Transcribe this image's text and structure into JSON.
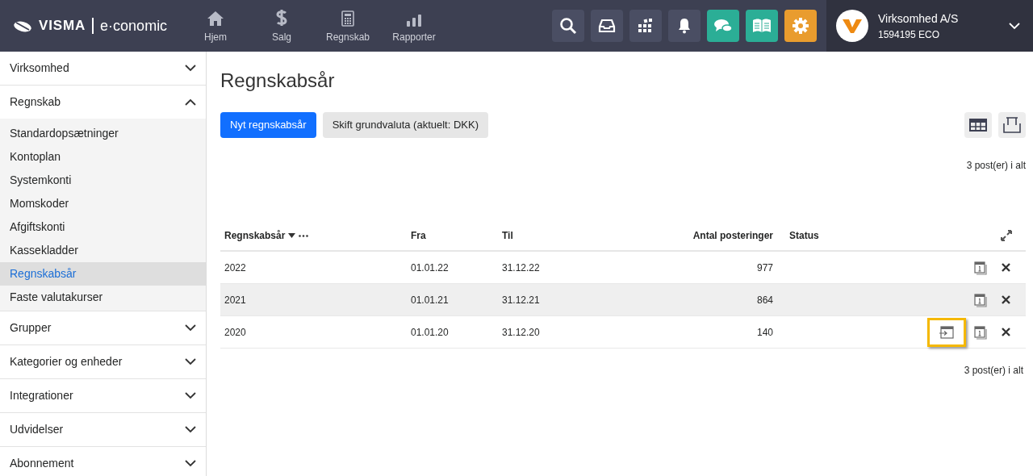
{
  "header": {
    "logo": {
      "brand": "VISMA",
      "product": "e·conomic"
    },
    "nav": [
      {
        "kind": "home",
        "label": "Hjem"
      },
      {
        "kind": "dollar",
        "label": "Salg"
      },
      {
        "kind": "calculator",
        "label": "Regnskab"
      },
      {
        "kind": "bars",
        "label": "Rapporter"
      }
    ],
    "tools": [
      {
        "kind": "search",
        "color": "#4a4e63"
      },
      {
        "kind": "inbox",
        "color": "#4a4e63"
      },
      {
        "kind": "apps",
        "color": "#4a4e63"
      },
      {
        "kind": "bell",
        "color": "#4a4e63"
      },
      {
        "kind": "chat",
        "color": "#2bae96"
      },
      {
        "kind": "book",
        "color": "#2bae96"
      },
      {
        "kind": "gear",
        "color": "#e99c2e"
      }
    ],
    "company": {
      "name": "Virksomhed A/S",
      "id": "1594195 ECO"
    }
  },
  "sidebar": [
    {
      "label": "Virksomhed",
      "expanded": false
    },
    {
      "label": "Regnskab",
      "expanded": true,
      "children": [
        {
          "label": "Standardopsætninger",
          "selected": false
        },
        {
          "label": "Kontoplan",
          "selected": false
        },
        {
          "label": "Systemkonti",
          "selected": false
        },
        {
          "label": "Momskoder",
          "selected": false
        },
        {
          "label": "Afgiftskonti",
          "selected": false
        },
        {
          "label": "Kassekladder",
          "selected": false
        },
        {
          "label": "Regnskabsår",
          "selected": true
        },
        {
          "label": "Faste valutakurser",
          "selected": false
        }
      ]
    },
    {
      "label": "Grupper",
      "expanded": false
    },
    {
      "label": "Kategorier og enheder",
      "expanded": false
    },
    {
      "label": "Integrationer",
      "expanded": false
    },
    {
      "label": "Udvidelser",
      "expanded": false
    },
    {
      "label": "Abonnement",
      "expanded": false
    }
  ],
  "page": {
    "title": "Regnskabsår",
    "buttons": [
      {
        "label": "Nyt regnskabsår",
        "kind": "primary"
      },
      {
        "label": "Skift grundvaluta (aktuelt: DKK)",
        "kind": "secondary"
      }
    ],
    "count_top": "3 post(er) i alt",
    "count_bottom": "3 post(er) i alt"
  },
  "table": {
    "columns": [
      "Regnskabsår",
      "Fra",
      "Til",
      "Antal posteringer",
      "Status"
    ],
    "rows": [
      {
        "year": "2022",
        "from": "01.01.22",
        "to": "31.12.22",
        "postings": "977",
        "shaded": false,
        "transfer_action": false
      },
      {
        "year": "2021",
        "from": "01.01.21",
        "to": "31.12.21",
        "postings": "864",
        "shaded": true,
        "transfer_action": false
      },
      {
        "year": "2020",
        "from": "01.01.20",
        "to": "31.12.20",
        "postings": "140",
        "shaded": false,
        "transfer_action": true
      }
    ]
  }
}
